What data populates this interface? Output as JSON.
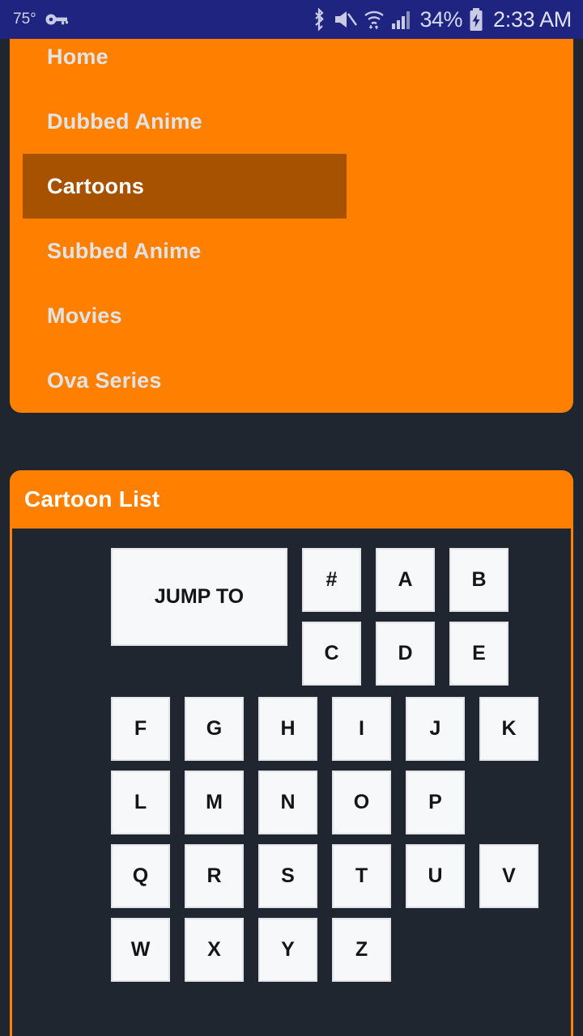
{
  "status_bar": {
    "temperature": "75°",
    "vpn_icon": "key-icon",
    "bluetooth_icon": "bluetooth-icon",
    "mute_icon": "volume-mute-icon",
    "wifi_icon": "wifi-icon",
    "signal_icon": "cellular-signal-icon",
    "battery_percent": "34%",
    "battery_icon": "battery-charging-icon",
    "time": "2:33 AM",
    "background_color": "#1f2480",
    "text_color": "#d7d9ec"
  },
  "nav": {
    "background_color": "#ff7f00",
    "active_background_color": "#a65200",
    "items": [
      {
        "label": "Home",
        "active": false
      },
      {
        "label": "Dubbed Anime",
        "active": false
      },
      {
        "label": "Cartoons",
        "active": true
      },
      {
        "label": "Subbed Anime",
        "active": false
      },
      {
        "label": "Movies",
        "active": false
      },
      {
        "label": "Ova Series",
        "active": false
      }
    ]
  },
  "card": {
    "title": "Cartoon List",
    "header_color": "#ff7f00",
    "border_color": "#ff7f00",
    "body_color": "#1f262f"
  },
  "jump_to": {
    "button_label": "JUMP TO",
    "button_bg": "#f7f8f9",
    "button_text_color": "#131519",
    "rows": [
      [
        "#",
        "A",
        "B"
      ],
      [
        "C",
        "D",
        "E"
      ],
      [
        "F",
        "G",
        "H",
        "I",
        "J",
        "K"
      ],
      [
        "L",
        "M",
        "N",
        "O",
        "P"
      ],
      [
        "Q",
        "R",
        "S",
        "T",
        "U",
        "V"
      ],
      [
        "W",
        "X",
        "Y",
        "Z"
      ]
    ]
  }
}
